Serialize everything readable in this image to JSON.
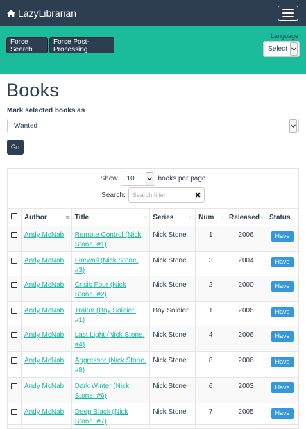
{
  "nav": {
    "brand": "LazyLibrarian",
    "brand_icon": "home-icon",
    "menu_icon": "hamburger-menu-icon"
  },
  "actions": {
    "force_search": "Force Search",
    "force_post_processing": "Force Post-Processing",
    "language_label": "Language",
    "language_value": "Select"
  },
  "page": {
    "title": "Books",
    "mark_label": "Mark selected books as",
    "mark_value": "Wanted",
    "go_label": "Go"
  },
  "table_controls": {
    "show_label": "Show",
    "per_page": "10",
    "per_page_suffix": "books per page",
    "search_label": "Search:",
    "search_placeholder": "Search filter"
  },
  "columns": [
    "Author",
    "Title",
    "Series",
    "Num",
    "Released",
    "Status"
  ],
  "rows": [
    {
      "author": "Andy McNab",
      "title": "Remote Control (Nick Stone, #1)",
      "series": "Nick Stone",
      "num": "1",
      "released": "2006",
      "status": "Have"
    },
    {
      "author": "Andy McNab",
      "title": "Firewall (Nick Stone, #3)",
      "series": "Nick Stone",
      "num": "3",
      "released": "2004",
      "status": "Have"
    },
    {
      "author": "Andy McNab",
      "title": "Crisis Four (Nick Stone, #2)",
      "series": "Nick Stone",
      "num": "2",
      "released": "2000",
      "status": "Have"
    },
    {
      "author": "Andy McNab",
      "title": "Traitor (Boy Soldier, #1)",
      "series": "Boy Soldier",
      "num": "1",
      "released": "2006",
      "status": "Have"
    },
    {
      "author": "Andy McNab",
      "title": "Last Light (Nick Stone, #4)",
      "series": "Nick Stone",
      "num": "4",
      "released": "2006",
      "status": "Have"
    },
    {
      "author": "Andy McNab",
      "title": "Aggressor (Nick Stone, #8)",
      "series": "Nick Stone",
      "num": "8",
      "released": "2006",
      "status": "Have"
    },
    {
      "author": "Andy McNab",
      "title": "Dark Winter (Nick Stone, #6)",
      "series": "Nick Stone",
      "num": "6",
      "released": "2003",
      "status": "Have"
    },
    {
      "author": "Andy McNab",
      "title": "Deep Black (Nick Stone, #7)",
      "series": "Nick Stone",
      "num": "7",
      "released": "2005",
      "status": "Have"
    }
  ],
  "colors": {
    "navbar": "#2c3e50",
    "accent": "#1abc9c",
    "link": "#18bc9c",
    "status_badge": "#3498db"
  }
}
